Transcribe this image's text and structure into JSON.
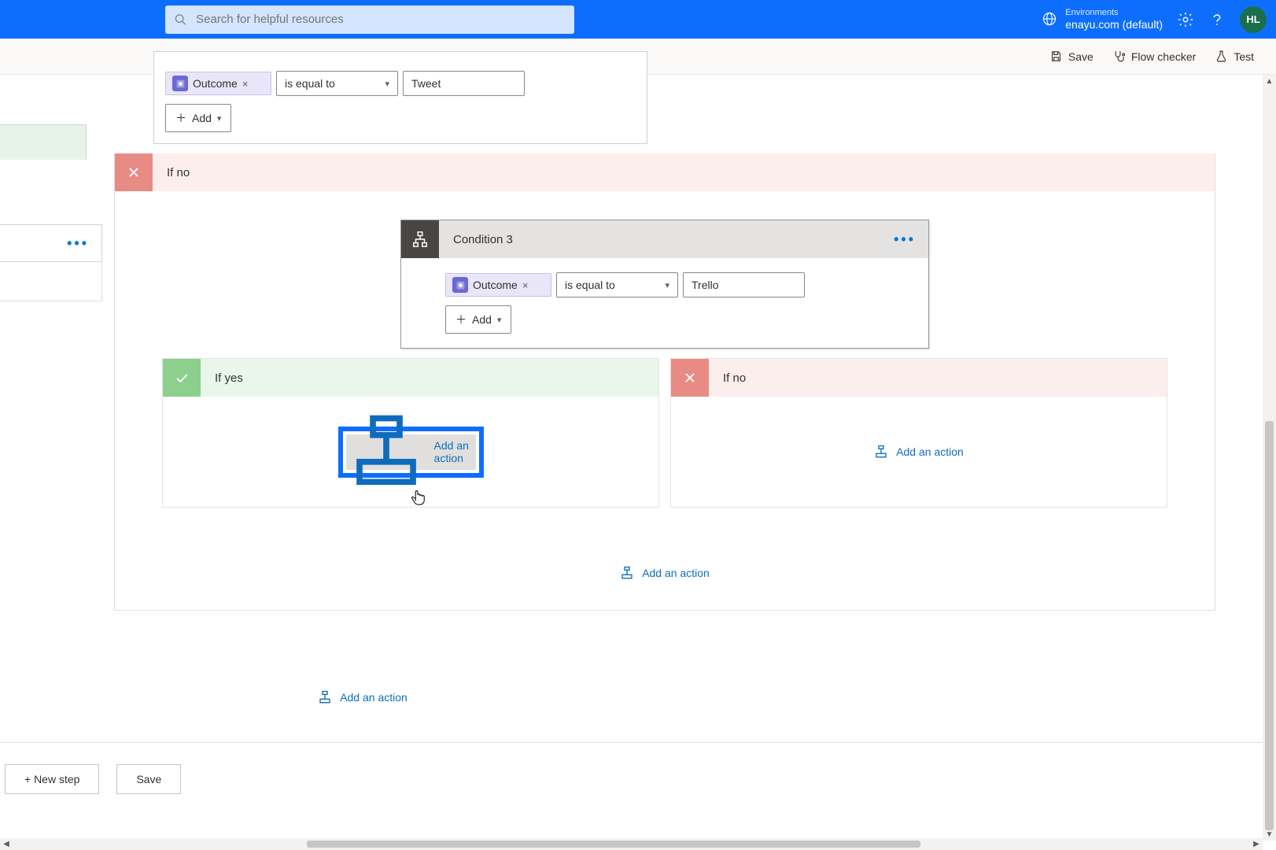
{
  "header": {
    "search_placeholder": "Search for helpful resources",
    "env_label": "Environments",
    "env_value": "enayu.com (default)",
    "avatar_initials": "HL"
  },
  "toolbar": {
    "save": "Save",
    "flow_checker": "Flow checker",
    "test": "Test"
  },
  "upper_condition": {
    "token_label": "Outcome",
    "operator": "is equal to",
    "value": "Tweet",
    "add_label": "Add"
  },
  "outer_branch": {
    "if_no_label": "If no"
  },
  "condition_card": {
    "title": "Condition 3",
    "token_label": "Outcome",
    "operator": "is equal to",
    "value": "Trello",
    "add_label": "Add"
  },
  "inner_branches": {
    "if_yes_label": "If yes",
    "if_no_label": "If no",
    "add_action_label": "Add an action"
  },
  "footer": {
    "new_step": "+ New step",
    "save": "Save"
  }
}
